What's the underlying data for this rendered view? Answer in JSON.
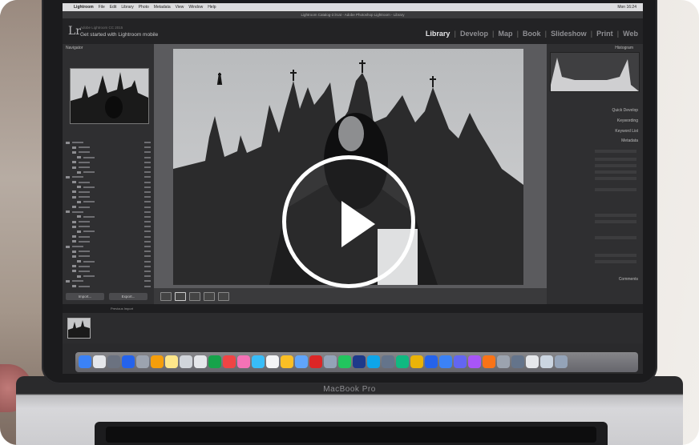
{
  "menubar": {
    "items": [
      "Lightroom",
      "File",
      "Edit",
      "Library",
      "Photo",
      "Metadata",
      "View",
      "Window",
      "Help"
    ],
    "status": "Mon 16:24"
  },
  "window_title": "Lightroom Catalog-2.lrcat - Adobe Photoshop Lightroom - Library",
  "lightroom": {
    "logo": "Lr",
    "identity": "Adobe Lightroom CC 2015",
    "mobile": "Get started with Lightroom mobile",
    "modules": [
      "Library",
      "Develop",
      "Map",
      "Book",
      "Slideshow",
      "Print",
      "Web"
    ],
    "active_module": "Library",
    "navigator": "Navigator",
    "import_button": "Import...",
    "export_button": "Export...",
    "histogram": "Histogram",
    "right_sections": [
      "Quick Develop",
      "Keywording",
      "Keyword List",
      "Metadata",
      "Comments"
    ],
    "filmstrip": "Previous Import"
  },
  "laptop_label": "MacBook Pro",
  "play_button": "play",
  "colors": {
    "play": "#ffffff",
    "lid": "#1b1b1d"
  }
}
